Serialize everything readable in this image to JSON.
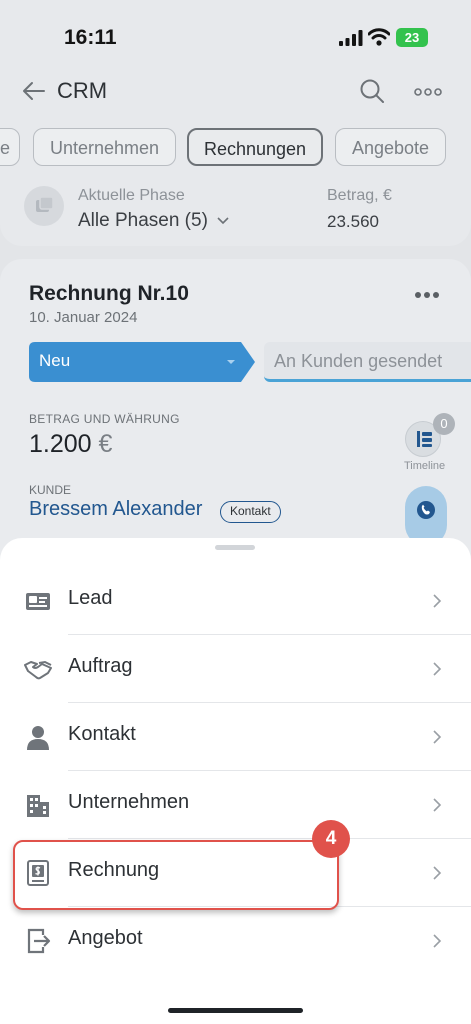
{
  "status_bar": {
    "time": "16:11",
    "battery": "23"
  },
  "nav": {
    "title": "CRM"
  },
  "tabs": [
    {
      "label": "e"
    },
    {
      "label": "Unternehmen"
    },
    {
      "label": "Rechnungen"
    },
    {
      "label": "Angebote"
    }
  ],
  "filter": {
    "phase_label": "Aktuelle Phase",
    "phase_value": "Alle Phasen (5)",
    "amount_label": "Betrag, €",
    "amount_value": "23.560"
  },
  "card": {
    "title": "Rechnung Nr.10",
    "date": "10. Januar 2024",
    "stage_current": "Neu",
    "stage_next": "An Kunden gesendet",
    "sum_caption": "BETRAG UND WÄHRUNG",
    "sum_value": "1.200",
    "sum_currency": "€",
    "timeline_count": "0",
    "timeline_label": "Timeline",
    "client_caption": "KUNDE",
    "client_name": "Bressem Alexander",
    "client_chip": "Kontakt"
  },
  "sheet": {
    "items": [
      {
        "label": "Lead",
        "icon": "id-card-icon"
      },
      {
        "label": "Auftrag",
        "icon": "handshake-icon"
      },
      {
        "label": "Kontakt",
        "icon": "person-icon"
      },
      {
        "label": "Unternehmen",
        "icon": "building-icon"
      },
      {
        "label": "Rechnung",
        "icon": "invoice-icon"
      },
      {
        "label": "Angebot",
        "icon": "quote-icon"
      }
    ],
    "highlight_step": "4"
  },
  "colors": {
    "accent_blue": "#3a8fd1",
    "highlight_red": "#e0524b",
    "link_blue": "#22578f"
  }
}
